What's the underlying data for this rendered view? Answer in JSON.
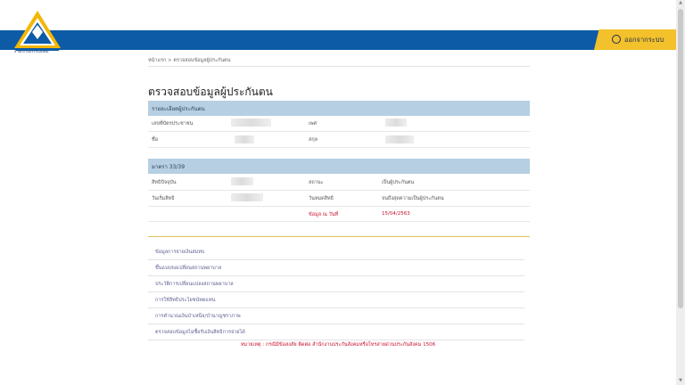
{
  "header": {
    "org_name": "สำนักงานประกันสังคม",
    "logout_label": "ออกจากระบบ",
    "logout_icon": "power-icon",
    "colors": {
      "brand_blue": "#0d5ba6",
      "logout_yellow": "#f3c12b",
      "section_blue": "#b6cfe2",
      "alert_red": "#c8102e"
    }
  },
  "breadcrumb": "หน้าแรก > ตรวจสอบข้อมูลผู้ประกันตน",
  "page_title": "ตรวจสอบข้อมูลผู้ประกันตน",
  "insured_section": {
    "heading": "รายละเอียดผู้ประกันตน",
    "id_label": "เลขที่บัตรประชาชน",
    "gender_label": "เพศ",
    "name_label": "ชื่อ",
    "surname_label": "สกุล"
  },
  "article_section": {
    "heading": "มาตรา 33/39",
    "rights_label": "สิทธิปัจจุบัน",
    "status_label": "สถานะ",
    "status_value": "เป็นผู้ประกันตน",
    "effective_label": "วันเริ่มสิทธิ",
    "expiry_label": "วันหมดสิทธิ",
    "expiry_value": "จนถึงสุดความเป็นผู้ประกันตน",
    "data_as_of_label": "ข้อมูล ณ วันที่",
    "data_as_of_value": "15/04/2563"
  },
  "links": [
    "ข้อมูลการจ่ายเงินสมทบ",
    "ขึ้นแบบขอเปลี่ยนสถานพยาบาล",
    "ประวัติการเปลี่ยนแปลงสถานพยาบาล",
    "การใช้สิทธิประโยชน์ทดแทน",
    "การคำนวณเงินบำเหน็จ/บำนาญชราภาพ",
    "ตรวจสอบข้อมูลไม่ซื้อรับเงินสิทธิการจ่ายได้"
  ],
  "footer_note": "หมายเหตุ : กรณีมีข้อสงสัย ติดต่อ สำนักงานประกันสังคมหรือโทรสายด่วนประกันสังคม 1506"
}
